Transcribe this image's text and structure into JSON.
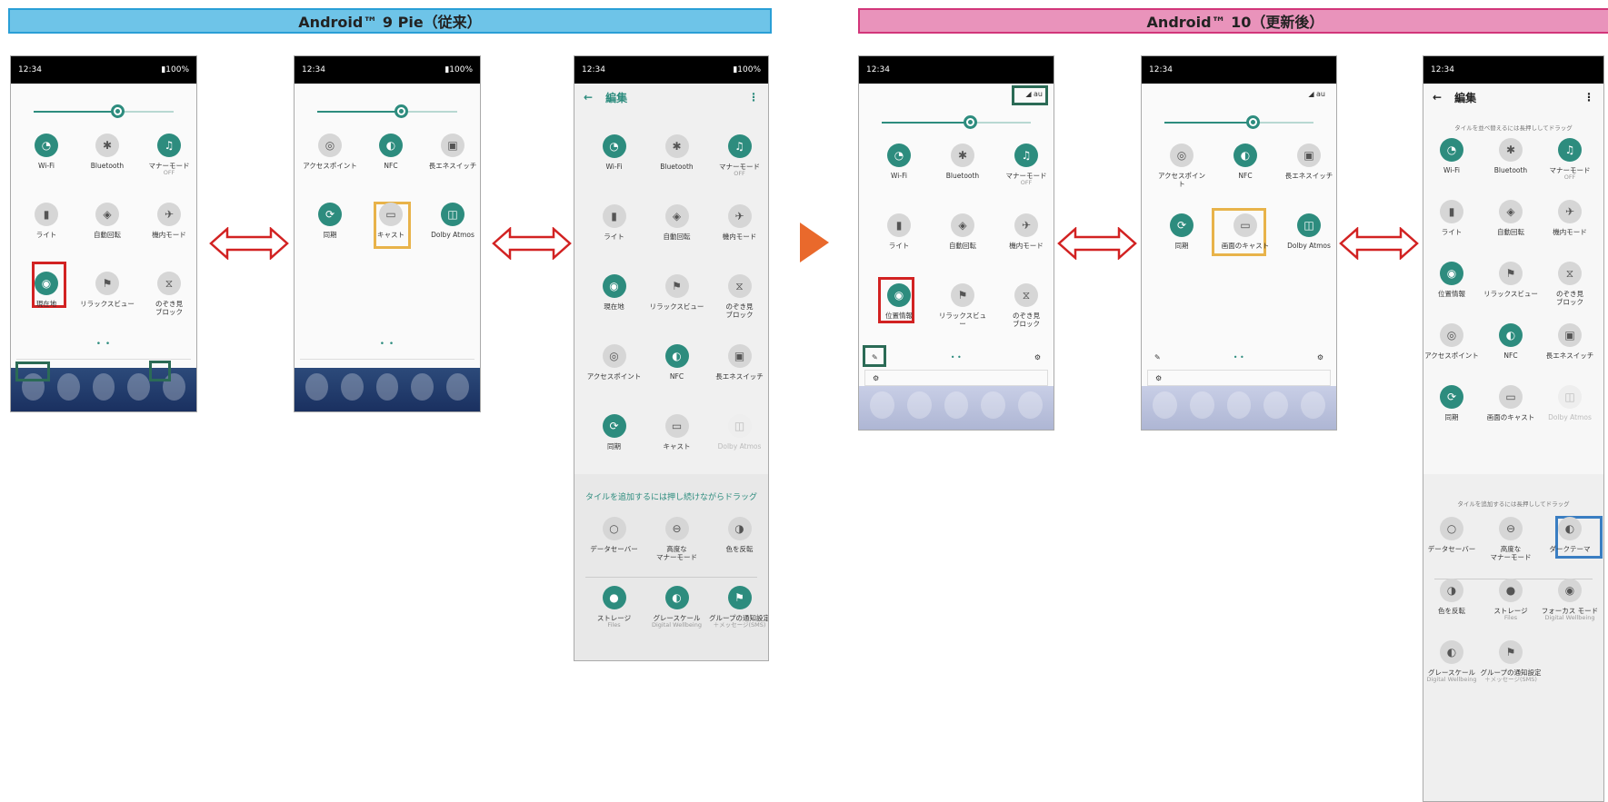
{
  "banners": {
    "pie": "Android™ 9 Pie（従来）",
    "ten": "Android™ 10（更新後）"
  },
  "status": {
    "time": "12:34",
    "battery": "▮100%"
  },
  "signal": "◢ au",
  "edit": {
    "back": "←",
    "title": "編集",
    "more": "⋮"
  },
  "pie_qs_page1": [
    {
      "label": "Wi-Fi",
      "icon": "wifi-icon",
      "glyph": "◔",
      "state": "on"
    },
    {
      "label": "Bluetooth",
      "icon": "bluetooth-icon",
      "glyph": "✱",
      "state": "off"
    },
    {
      "label": "マナーモード",
      "sub": "OFF",
      "icon": "bell-icon",
      "glyph": "♫",
      "state": "on"
    },
    {
      "label": "ライト",
      "icon": "flashlight-icon",
      "glyph": "▮",
      "state": "off"
    },
    {
      "label": "自動回転",
      "icon": "rotate-icon",
      "glyph": "◈",
      "state": "off"
    },
    {
      "label": "機内モード",
      "icon": "airplane-icon",
      "glyph": "✈",
      "state": "off"
    },
    {
      "label": "現在地",
      "icon": "location-icon",
      "glyph": "◉",
      "state": "on"
    },
    {
      "label": "リラックスビュー",
      "icon": "night-light-icon",
      "glyph": "⚑",
      "state": "off"
    },
    {
      "label": "のぞき見\nブロック",
      "icon": "privacy-icon",
      "glyph": "⧖",
      "state": "off"
    }
  ],
  "pie_qs_page2": [
    {
      "label": "アクセスポイント",
      "icon": "hotspot-icon",
      "glyph": "◎",
      "state": "off"
    },
    {
      "label": "NFC",
      "icon": "nfc-icon",
      "glyph": "◐",
      "state": "on"
    },
    {
      "label": "長エネスイッチ",
      "icon": "battery-saver-icon",
      "glyph": "▣",
      "state": "off"
    },
    {
      "label": "同期",
      "icon": "sync-icon",
      "glyph": "⟳",
      "state": "on"
    },
    {
      "label": "キャスト",
      "icon": "cast-icon",
      "glyph": "▭",
      "state": "off"
    },
    {
      "label": "Dolby Atmos",
      "icon": "dolby-icon",
      "glyph": "◫",
      "state": "on"
    }
  ],
  "pie_edit_tiles": [
    {
      "label": "Wi-Fi",
      "icon": "wifi-icon",
      "glyph": "◔",
      "state": "on"
    },
    {
      "label": "Bluetooth",
      "icon": "bluetooth-icon",
      "glyph": "✱",
      "state": "off"
    },
    {
      "label": "マナーモード",
      "sub": "OFF",
      "icon": "bell-icon",
      "glyph": "♫",
      "state": "on"
    },
    {
      "label": "ライト",
      "icon": "flashlight-icon",
      "glyph": "▮",
      "state": "off"
    },
    {
      "label": "自動回転",
      "icon": "rotate-icon",
      "glyph": "◈",
      "state": "off"
    },
    {
      "label": "機内モード",
      "icon": "airplane-icon",
      "glyph": "✈",
      "state": "off"
    },
    {
      "label": "現在地",
      "icon": "location-icon",
      "glyph": "◉",
      "state": "on"
    },
    {
      "label": "リラックスビュー",
      "icon": "night-light-icon",
      "glyph": "⚑",
      "state": "off"
    },
    {
      "label": "のぞき見\nブロック",
      "icon": "privacy-icon",
      "glyph": "⧖",
      "state": "off"
    },
    {
      "label": "アクセスポイント",
      "icon": "hotspot-icon",
      "glyph": "◎",
      "state": "off"
    },
    {
      "label": "NFC",
      "icon": "nfc-icon",
      "glyph": "◐",
      "state": "on"
    },
    {
      "label": "長エネスイッチ",
      "icon": "battery-saver-icon",
      "glyph": "▣",
      "state": "off"
    },
    {
      "label": "同期",
      "icon": "sync-icon",
      "glyph": "⟳",
      "state": "on"
    },
    {
      "label": "キャスト",
      "icon": "cast-icon",
      "glyph": "▭",
      "state": "off"
    },
    {
      "label": "Dolby Atmos",
      "icon": "dolby-icon",
      "glyph": "◫",
      "state": "faint"
    }
  ],
  "pie_add_hint": "タイルを追加するには押し続けながらドラッグ",
  "pie_add_tiles": [
    {
      "label": "データセーバー",
      "icon": "data-saver-icon",
      "glyph": "○",
      "state": "off"
    },
    {
      "label": "高度な\nマナーモード",
      "icon": "dnd-icon",
      "glyph": "⊖",
      "state": "off"
    },
    {
      "label": "色を反転",
      "icon": "invert-colors-icon",
      "glyph": "◑",
      "state": "off"
    },
    {
      "label": "ストレージ",
      "sub": "Files",
      "icon": "storage-icon",
      "glyph": "●",
      "state": "on"
    },
    {
      "label": "グレースケール",
      "sub": "Digital Wellbeing",
      "icon": "grayscale-icon",
      "glyph": "◐",
      "state": "on"
    },
    {
      "label": "グループの通知設定",
      "sub": "＋メッセージ(SMS)",
      "icon": "group-notify-icon",
      "glyph": "⚑",
      "state": "on"
    }
  ],
  "ten_qs_page1": [
    {
      "label": "Wi-Fi",
      "icon": "wifi-icon",
      "glyph": "◔",
      "state": "on"
    },
    {
      "label": "Bluetooth",
      "icon": "bluetooth-icon",
      "glyph": "✱",
      "state": "off"
    },
    {
      "label": "マナーモード",
      "sub": "OFF",
      "icon": "bell-icon",
      "glyph": "♫",
      "state": "on"
    },
    {
      "label": "ライト",
      "icon": "flashlight-icon",
      "glyph": "▮",
      "state": "off"
    },
    {
      "label": "自動回転",
      "icon": "rotate-icon",
      "glyph": "◈",
      "state": "off"
    },
    {
      "label": "機内モード",
      "icon": "airplane-icon",
      "glyph": "✈",
      "state": "off"
    },
    {
      "label": "位置情報",
      "icon": "location-icon",
      "glyph": "◉",
      "state": "on"
    },
    {
      "label": "リラックスビュ\nー",
      "icon": "night-light-icon",
      "glyph": "⚑",
      "state": "off"
    },
    {
      "label": "のぞき見\nブロック",
      "icon": "privacy-icon",
      "glyph": "⧖",
      "state": "off"
    }
  ],
  "ten_qs_page2": [
    {
      "label": "アクセスポイン\nト",
      "icon": "hotspot-icon",
      "glyph": "◎",
      "state": "off"
    },
    {
      "label": "NFC",
      "icon": "nfc-icon",
      "glyph": "◐",
      "state": "on"
    },
    {
      "label": "長エネスイッチ",
      "icon": "battery-saver-icon",
      "glyph": "▣",
      "state": "off"
    },
    {
      "label": "同期",
      "icon": "sync-icon",
      "glyph": "⟳",
      "state": "on"
    },
    {
      "label": "画面のキャスト",
      "icon": "cast-icon",
      "glyph": "▭",
      "state": "off"
    },
    {
      "label": "Dolby Atmos",
      "icon": "dolby-icon",
      "glyph": "◫",
      "state": "on"
    }
  ],
  "ten_edit_hint": "タイルを並べ替えるには長押ししてドラッグ",
  "ten_edit_tiles": [
    {
      "label": "Wi-Fi",
      "icon": "wifi-icon",
      "glyph": "◔",
      "state": "on"
    },
    {
      "label": "Bluetooth",
      "icon": "bluetooth-icon",
      "glyph": "✱",
      "state": "off"
    },
    {
      "label": "マナーモード",
      "sub": "OFF",
      "icon": "bell-icon",
      "glyph": "♫",
      "state": "on"
    },
    {
      "label": "ライト",
      "icon": "flashlight-icon",
      "glyph": "▮",
      "state": "off"
    },
    {
      "label": "自動回転",
      "icon": "rotate-icon",
      "glyph": "◈",
      "state": "off"
    },
    {
      "label": "機内モード",
      "icon": "airplane-icon",
      "glyph": "✈",
      "state": "off"
    },
    {
      "label": "位置情報",
      "icon": "location-icon",
      "glyph": "◉",
      "state": "on"
    },
    {
      "label": "リラックスビュー",
      "icon": "night-light-icon",
      "glyph": "⚑",
      "state": "off"
    },
    {
      "label": "のぞき見\nブロック",
      "icon": "privacy-icon",
      "glyph": "⧖",
      "state": "off"
    },
    {
      "label": "アクセスポイント",
      "icon": "hotspot-icon",
      "glyph": "◎",
      "state": "off"
    },
    {
      "label": "NFC",
      "icon": "nfc-icon",
      "glyph": "◐",
      "state": "on"
    },
    {
      "label": "長エネスイッチ",
      "icon": "battery-saver-icon",
      "glyph": "▣",
      "state": "off"
    },
    {
      "label": "同期",
      "icon": "sync-icon",
      "glyph": "⟳",
      "state": "on"
    },
    {
      "label": "画面のキャスト",
      "icon": "cast-icon",
      "glyph": "▭",
      "state": "off"
    },
    {
      "label": "Dolby Atmos",
      "icon": "dolby-icon",
      "glyph": "◫",
      "state": "faint"
    }
  ],
  "ten_add_hint": "タイルを追加するには長押ししてドラッグ",
  "ten_add_tiles": [
    {
      "label": "データセーバー",
      "icon": "data-saver-icon",
      "glyph": "○",
      "state": "off"
    },
    {
      "label": "高度な\nマナーモード",
      "icon": "dnd-icon",
      "glyph": "⊖",
      "state": "off"
    },
    {
      "label": "ダークテーマ",
      "icon": "dark-theme-icon",
      "glyph": "◐",
      "state": "off"
    },
    {
      "label": "色を反転",
      "icon": "invert-colors-icon",
      "glyph": "◑",
      "state": "off"
    },
    {
      "label": "ストレージ",
      "sub": "Files",
      "icon": "storage-icon",
      "glyph": "●",
      "state": "off"
    },
    {
      "label": "フォーカス モード",
      "sub": "Digital Wellbeing",
      "icon": "focus-mode-icon",
      "glyph": "◉",
      "state": "off"
    },
    {
      "label": "グレースケール",
      "sub": "Digital Wellbeing",
      "icon": "grayscale-icon",
      "glyph": "◐",
      "state": "off"
    },
    {
      "label": "グループの通知設定",
      "sub": "＋メッセージ(SMS)",
      "icon": "group-notify-icon",
      "glyph": "⚑",
      "state": "off"
    }
  ],
  "page_dots": "• •",
  "pencil": "✎",
  "gear": "⚙"
}
